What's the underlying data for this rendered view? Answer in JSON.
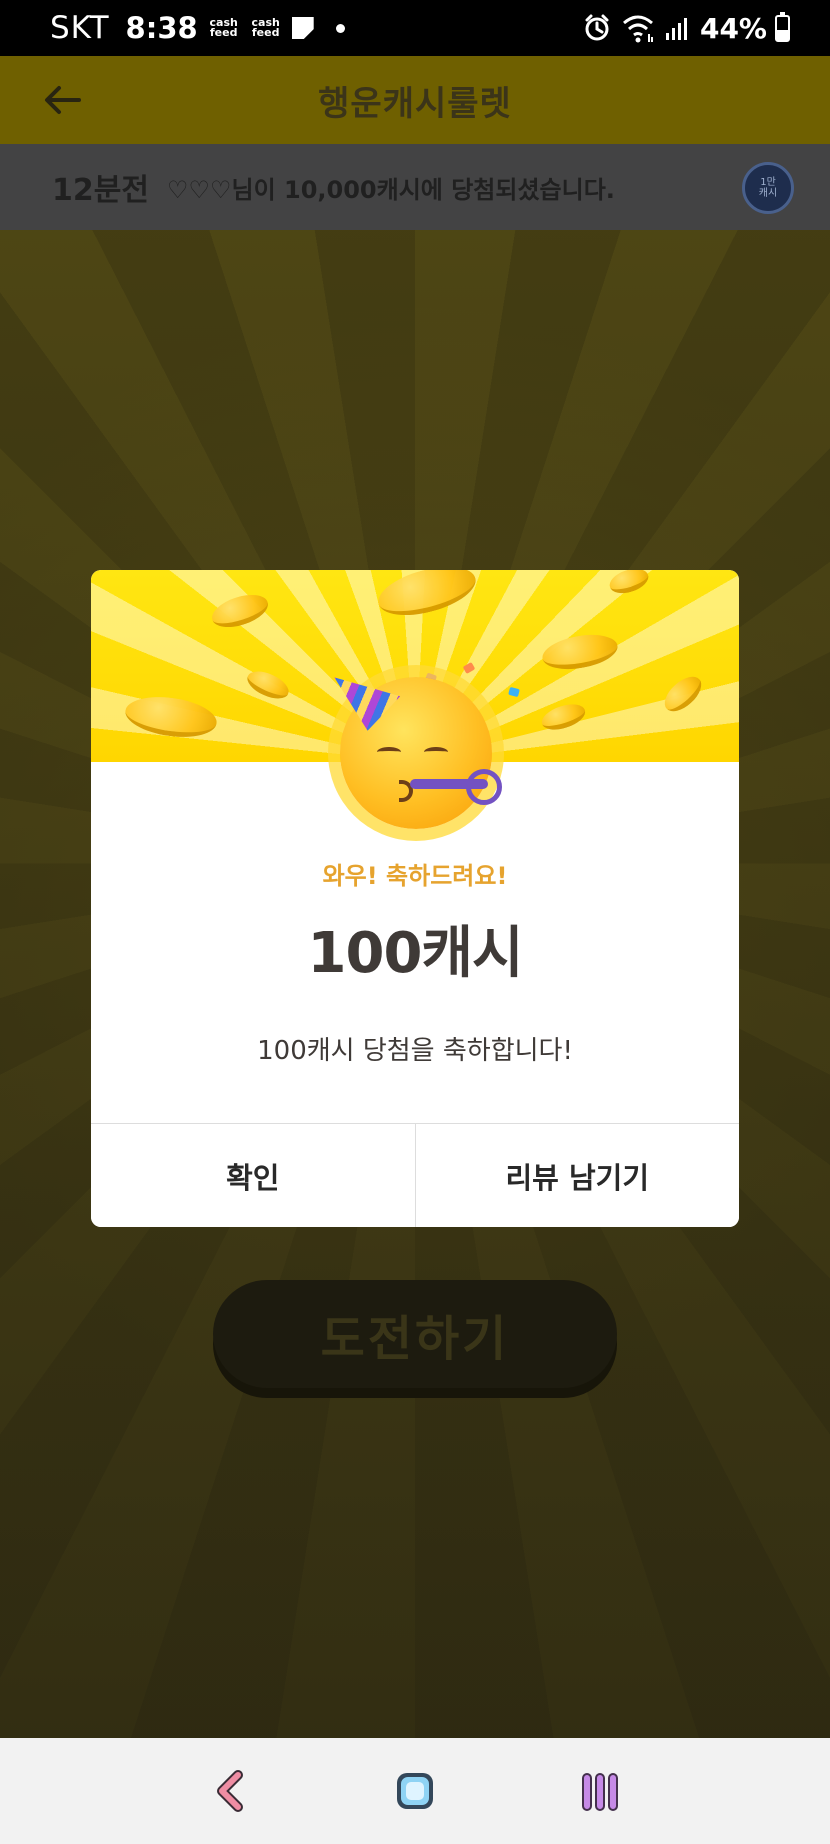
{
  "status_bar": {
    "carrier": "SKT",
    "time": "8:38",
    "notification_badges": [
      "cash\nfeed",
      "cash\nfeed"
    ],
    "battery": "44%",
    "icons": [
      "memo-icon",
      "dot-icon",
      "alarm-icon",
      "wifi-icon",
      "signal-icon",
      "battery-icon"
    ]
  },
  "header": {
    "title": "행운캐시룰렛",
    "back_icon": "arrow-left-icon"
  },
  "ticker": {
    "time": "12분전",
    "message": "♡♡♡님이 10,000캐시에 당첨되셨습니다.",
    "badge_line1": "1만",
    "badge_line2": "캐시"
  },
  "challenge_button": {
    "label": "도전하기"
  },
  "dialog": {
    "congrats": "와우! 축하드려요!",
    "amount": "100캐시",
    "message": "100캐시 당첨을 축하합니다!",
    "confirm_label": "확인",
    "review_label": "리뷰 남기기"
  },
  "colors": {
    "hero_yellow": "#ffdc00",
    "accent_orange": "#e6a32e",
    "text_dark": "#3f3a37",
    "overlay_background": "#2a2712"
  },
  "nav_bar": {
    "icons": [
      "back-icon",
      "home-icon",
      "recent-apps-icon"
    ]
  }
}
